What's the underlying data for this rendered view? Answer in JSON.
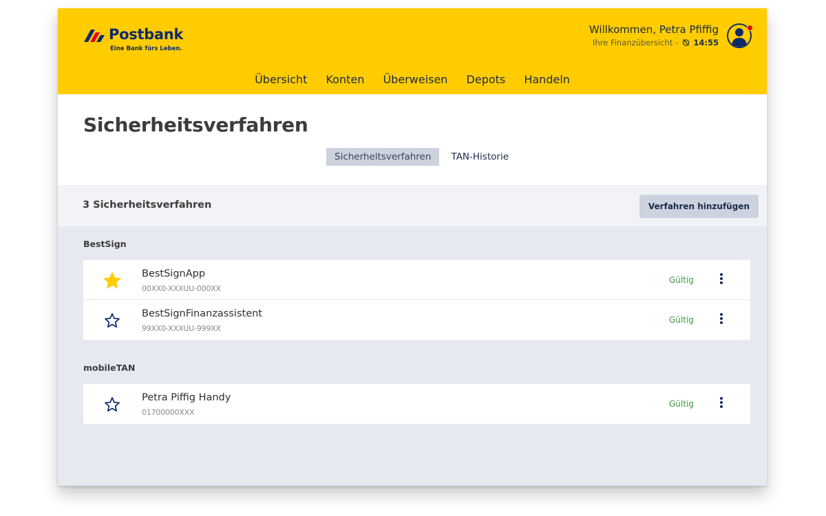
{
  "header": {
    "logo_name": "Postbank",
    "logo_claim": "Eine Bank fürs Leben.",
    "welcome": "Willkommen, Petra Pfiffig",
    "subtitle": "Ihre Finanzübersicht -",
    "time": "14:55",
    "brand_color": "#ffcc00",
    "primary_color": "#0f2a6b"
  },
  "nav": {
    "items": [
      {
        "label": "Übersicht"
      },
      {
        "label": "Konten"
      },
      {
        "label": "Überweisen"
      },
      {
        "label": "Depots"
      },
      {
        "label": "Handeln"
      }
    ]
  },
  "page": {
    "title": "Sicherheitsverfahren",
    "tabs": [
      {
        "label": "Sicherheitsverfahren",
        "active": true
      },
      {
        "label": "TAN-Historie",
        "active": false
      }
    ]
  },
  "toolbar": {
    "count_label": "3 Sicherheitsverfahren",
    "add_label": "Verfahren hinzufügen"
  },
  "groups": [
    {
      "label": "BestSign",
      "items": [
        {
          "title": "BestSignApp",
          "sub": "00XX0-XXXUU-000XX",
          "status": "Gültig",
          "favorite": true
        },
        {
          "title": "BestSignFinanzassistent",
          "sub": "99XX0-XXXUU-999XX",
          "status": "Gültig",
          "favorite": false
        }
      ]
    },
    {
      "label": "mobileTAN",
      "items": [
        {
          "title": "Petra Piffig Handy",
          "sub": "01700000XXX",
          "status": "Gültig",
          "favorite": false
        }
      ]
    }
  ]
}
